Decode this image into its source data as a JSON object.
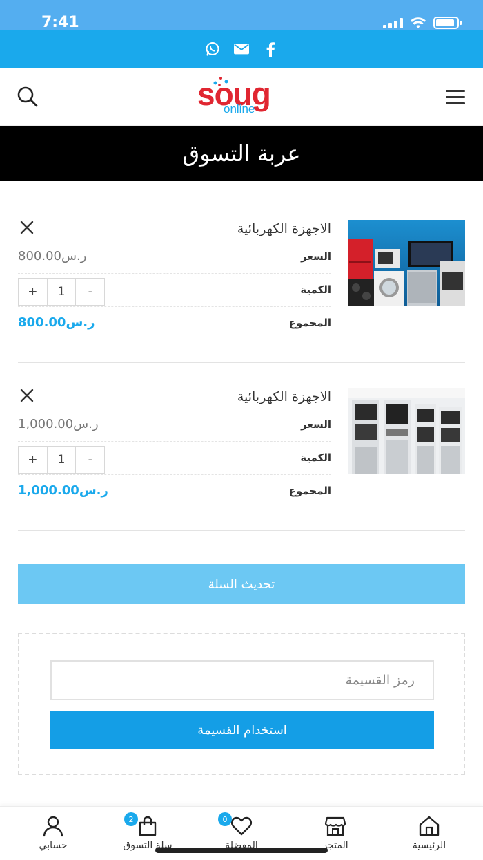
{
  "status_bar": {
    "time": "7:41"
  },
  "header": {
    "logo_main": "soug",
    "logo_sub": "online"
  },
  "page_title": "عربة التسوق",
  "cart_items": [
    {
      "name": "الاجهزة الكهربائية",
      "price_label": "السعر",
      "price": "800.00ر.س",
      "qty_label": "الكمية",
      "qty": "1",
      "total_label": "المجموع",
      "total": "800.00ر.س",
      "image": "kitchen appliances: fridge, microwave, TV, washing machine"
    },
    {
      "name": "الاجهزة الكهربائية",
      "price_label": "السعر",
      "price": "1,000.00ر.س",
      "qty_label": "الكمية",
      "qty": "1",
      "total_label": "المجموع",
      "total": "1,000.00ر.س",
      "image": "built-in ovens display"
    }
  ],
  "qty_controls": {
    "minus": "-",
    "plus": "+"
  },
  "update_cart_label": "تحديث السلة",
  "coupon": {
    "placeholder": "رمز القسيمة",
    "apply_label": "استخدام القسيمة"
  },
  "tabbar": {
    "items": [
      {
        "label": "الرئيسية",
        "icon": "home-icon"
      },
      {
        "label": "المتجر",
        "icon": "store-icon"
      },
      {
        "label": "المفضلة",
        "icon": "heart-icon",
        "badge": "0"
      },
      {
        "label": "سلة التسوق",
        "icon": "bag-icon",
        "badge": "2"
      },
      {
        "label": "حسابي",
        "icon": "user-icon"
      }
    ]
  },
  "colors": {
    "primary": "#1aa9ec",
    "update_button": "#6cc8f3",
    "logo_red": "#e02631",
    "title_bar": "#000000"
  }
}
